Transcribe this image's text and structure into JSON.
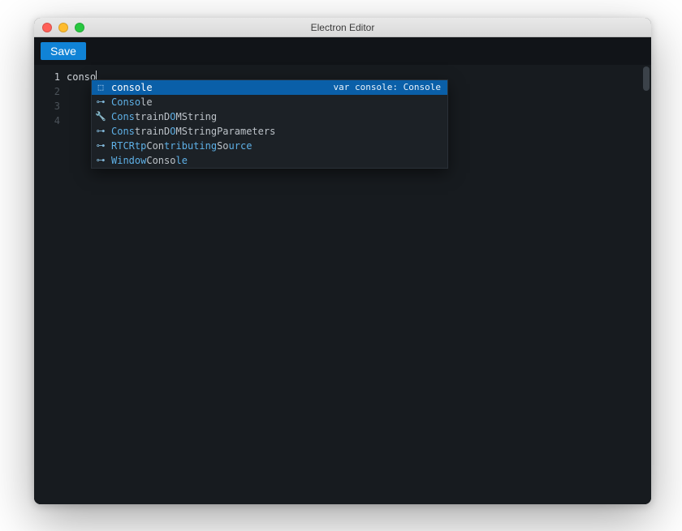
{
  "window": {
    "title": "Electron Editor"
  },
  "toolbar": {
    "save_label": "Save"
  },
  "editor": {
    "typed": "conso",
    "line_numbers": [
      "1",
      "2",
      "3",
      "4"
    ],
    "active_line_index": 0
  },
  "autocomplete": {
    "items": [
      {
        "icon": "⬚",
        "segments": [
          "conso",
          "le"
        ],
        "detail": "var console: Console",
        "selected": true,
        "kind": "variable"
      },
      {
        "icon": "⊶",
        "segments": [
          "Conso",
          "le"
        ],
        "detail": "",
        "selected": false,
        "kind": "class"
      },
      {
        "icon": "🔧",
        "segments": [
          "Cons",
          "trainD",
          "O",
          "MString"
        ],
        "detail": "",
        "selected": false,
        "kind": "method"
      },
      {
        "icon": "⊶",
        "segments": [
          "Cons",
          "trainD",
          "O",
          "MStringParameters"
        ],
        "detail": "",
        "selected": false,
        "kind": "class"
      },
      {
        "icon": "⊶",
        "segments": [
          "RTCRtp",
          "Con",
          "tributing",
          "So",
          "urce"
        ],
        "detail": "",
        "selected": false,
        "kind": "class"
      },
      {
        "icon": "⊶",
        "segments": [
          "Window",
          "Conso",
          "le"
        ],
        "detail": "",
        "selected": false,
        "kind": "class"
      }
    ]
  }
}
